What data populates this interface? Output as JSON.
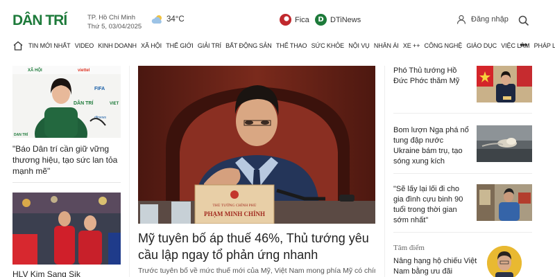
{
  "header": {
    "logo": "DÂN TRÍ",
    "city": "TP. Hồ Chí Minh",
    "date": "Thứ 5, 03/04/2025",
    "temperature": "34°C",
    "partners": [
      "Fica",
      "DTiNews"
    ],
    "login_label": "Đăng nhập"
  },
  "nav": {
    "items": [
      "TIN MỚI NHẤT",
      "VIDEO",
      "KINH DOANH",
      "XÃ HỘI",
      "THẾ GIỚI",
      "GIẢI TRÍ",
      "BẤT ĐỘNG SẢN",
      "THỂ THAO",
      "SỨC KHỎE",
      "NỘI VỤ",
      "NHÂN ÁI",
      "XE ++",
      "CÔNG NGHỆ",
      "GIÁO DỤC",
      "VIỆC LÀM",
      "PHÁP LUẬT"
    ],
    "more": "•••"
  },
  "left": {
    "article1": {
      "title": "\"Báo Dân trí cần giữ vững thương hiệu, tạo sức lan tỏa mạnh mẽ\"",
      "backdrop": [
        "XÃ HỘI",
        "viettel",
        "FIFA",
        "DÂN TRÍ",
        "dtinews",
        "VIET",
        "DAN TRÍ"
      ]
    },
    "article2": {
      "title": "HLV Kim Sang Sik"
    }
  },
  "main": {
    "title": "Mỹ tuyên bố áp thuế 46%, Thủ tướng yêu cầu lập ngay tổ phản ứng nhanh",
    "sapo": "Trước tuyên bố về mức thuế mới của Mỹ, Việt Nam mong phía Mỹ có chính sách",
    "placard_top": "THỦ TƯỚNG CHÍNH PHỦ",
    "placard_name": "PHẠM MINH CHÍNH"
  },
  "right": {
    "items": [
      {
        "title": "Phó Thủ tướng Hồ Đức Phớc thăm Mỹ"
      },
      {
        "title": "Bom lượn Nga phá nổ tung đập nước Ukraine bám trụ, tạo sóng xung kích"
      },
      {
        "title": "\"Sẽ lấy lại lối đi cho gia đình cựu binh 90 tuổi trong thời gian sớm nhất\""
      }
    ],
    "tam_diem_label": "Tâm điểm",
    "tam_diem_title": "Nâng hạng hộ chiếu Việt Nam bằng ưu đãi"
  },
  "colors": {
    "brand": "#1d7a3a",
    "text": "#222222"
  }
}
